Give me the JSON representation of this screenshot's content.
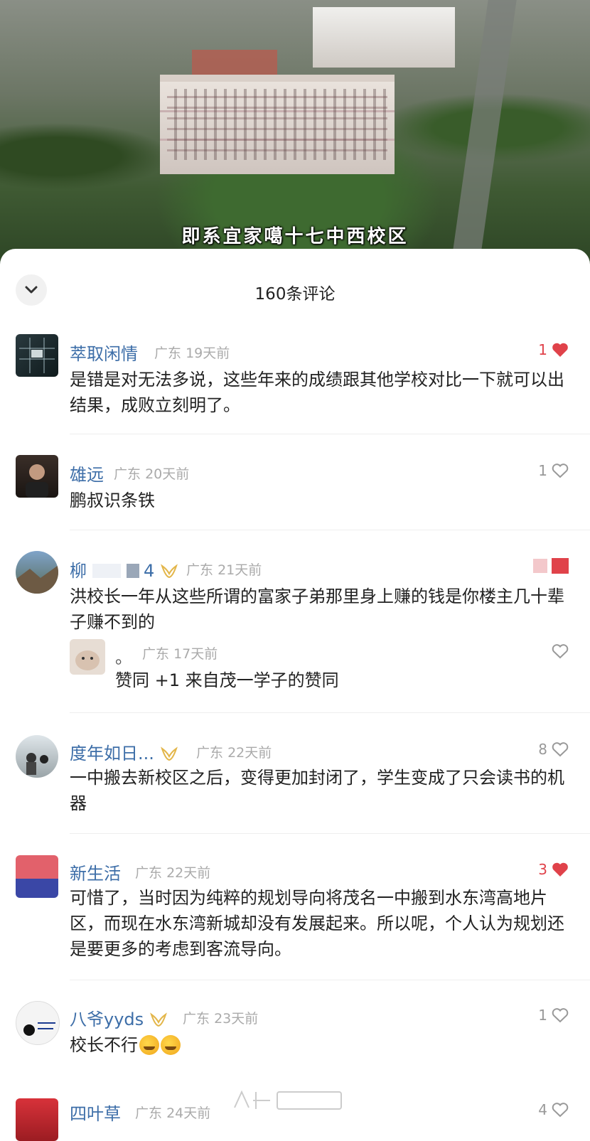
{
  "video": {
    "caption": "即系宜家噶十七中西校区"
  },
  "sheet": {
    "title": "160条评论",
    "collapse_icon": "chevron-down-icon"
  },
  "comments": [
    {
      "name": "萃取闲情",
      "region": "广东",
      "time": "19天前",
      "likes": "1",
      "liked": true,
      "text": "是错是对无法多说，这些年来的成绩跟其他学校对比一下就可以出结果，成败立刻明了。"
    },
    {
      "name": "雄远",
      "region": "广东",
      "time": "20天前",
      "likes": "1",
      "liked": false,
      "text": "鹏叔识条铁"
    },
    {
      "name": "柳",
      "name_suffix": "4",
      "region": "广东",
      "time": "21天前",
      "likes": "",
      "liked": true,
      "text": "洪校长一年从这些所谓的富家子弟那里身上赚的钱是你楼主几十辈子赚不到的",
      "reply": {
        "name": "。",
        "region": "广东",
        "time": "17天前",
        "text": "赞同 +1 来自茂一学子的赞同"
      }
    },
    {
      "name": "度年如日...",
      "region": "广东",
      "time": "22天前",
      "likes": "8",
      "liked": false,
      "text": "一中搬去新校区之后，变得更加封闭了，学生变成了只会读书的机器"
    },
    {
      "name": "新生活",
      "region": "广东",
      "time": "22天前",
      "likes": "3",
      "liked": true,
      "text": "可惜了，当时因为纯粹的规划导向将茂名一中搬到水东湾高地片区，而现在水东湾新城却没有发展起来。所以呢，个人认为规划还是要更多的考虑到客流导向。"
    },
    {
      "name": "八爷yyds",
      "region": "广东",
      "time": "23天前",
      "likes": "1",
      "liked": false,
      "text": "校长不行"
    },
    {
      "name": "四叶草",
      "region": "广东",
      "time": "24天前",
      "likes": "4",
      "liked": false,
      "text": ""
    }
  ],
  "colors": {
    "name": "#3d6ea8",
    "liked": "#e0424a",
    "meta": "#aaaaaa"
  }
}
